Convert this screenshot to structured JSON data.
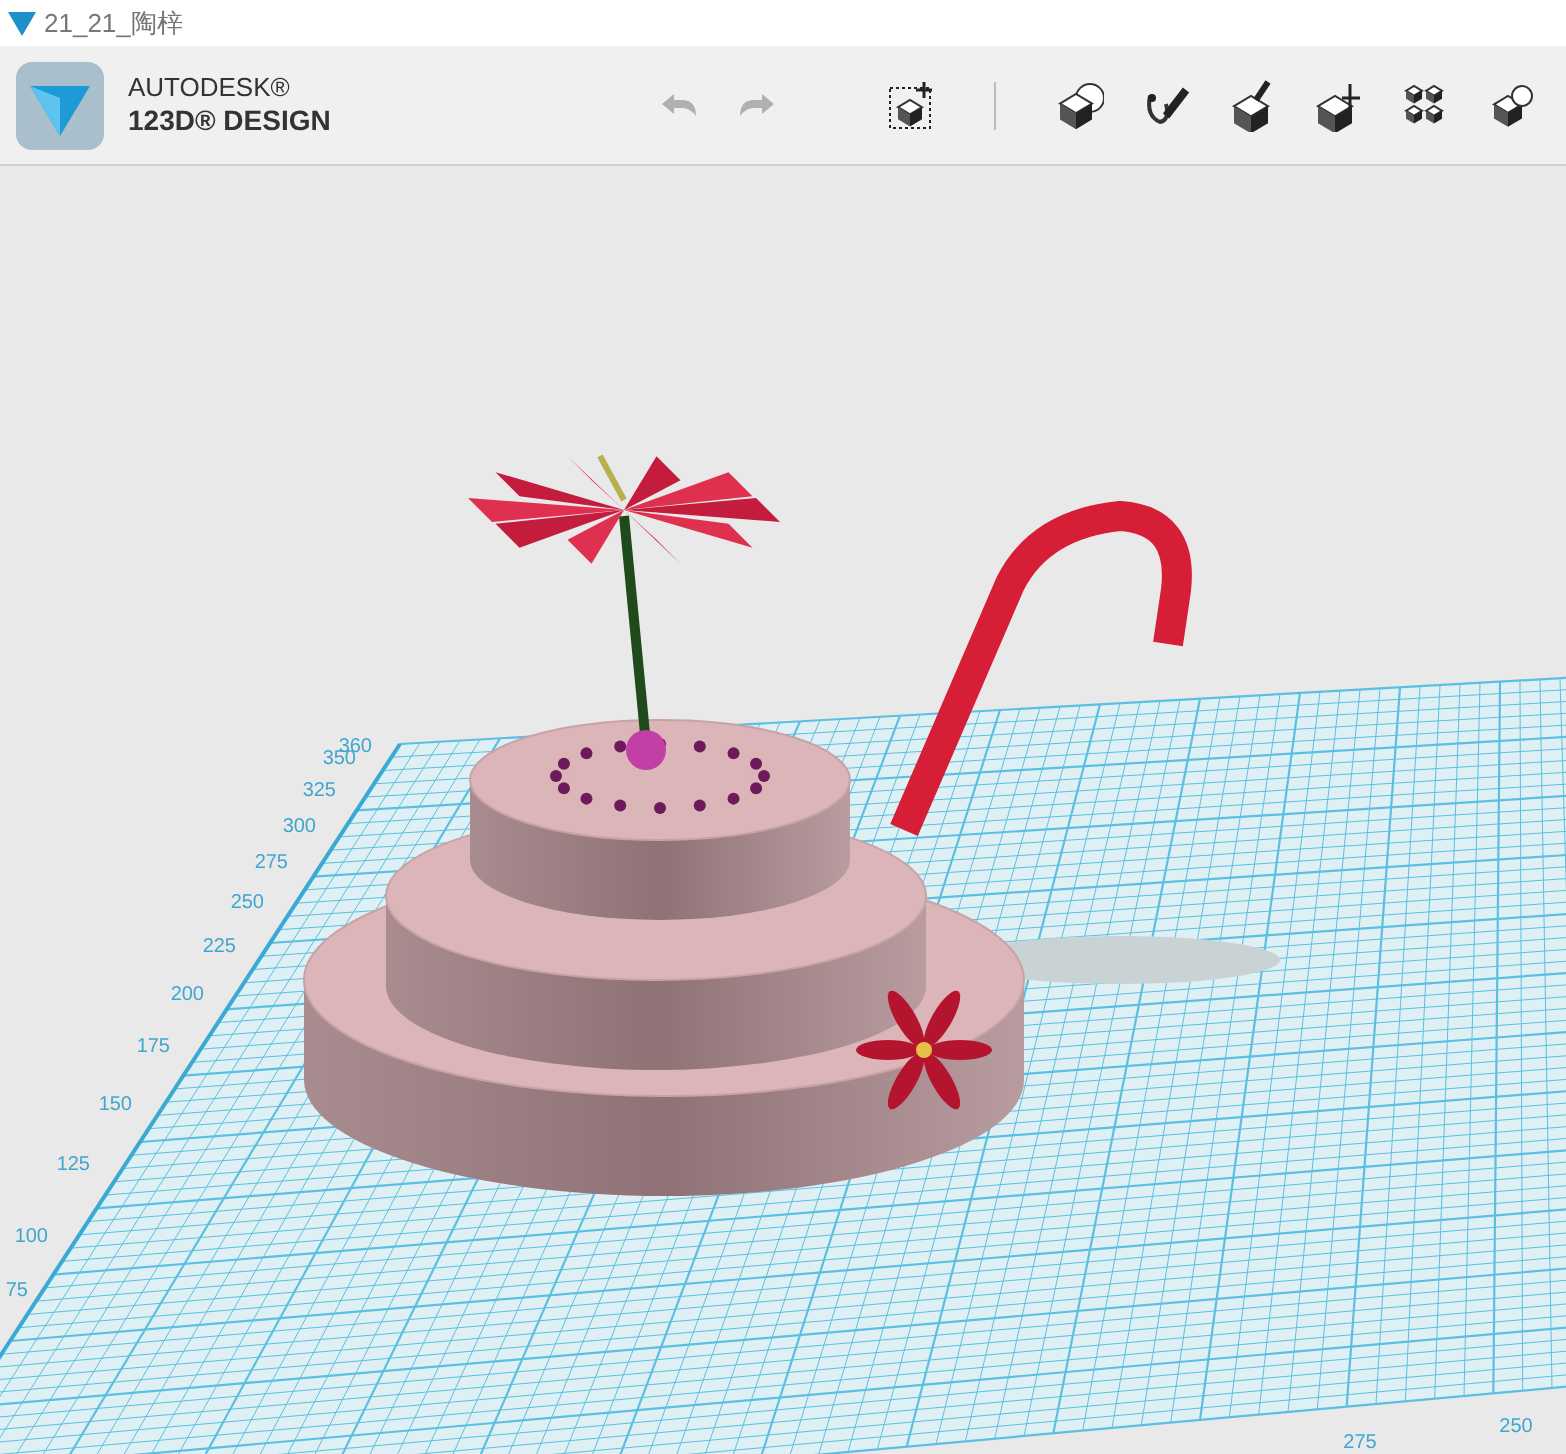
{
  "window": {
    "title": "21_21_陶梓"
  },
  "app": {
    "brand": "AUTODESK®",
    "product": "123D® DESIGN"
  },
  "history": [
    {
      "kind": "undo",
      "disabled": true
    },
    {
      "kind": "redo",
      "disabled": true
    }
  ],
  "tools": [
    {
      "kind": "transform"
    },
    {
      "kind": "primitives"
    },
    {
      "kind": "sketch"
    },
    {
      "kind": "construct"
    },
    {
      "kind": "modify"
    },
    {
      "kind": "pattern"
    },
    {
      "kind": "group"
    }
  ],
  "grid_labels": {
    "side": [
      "360",
      "350",
      "325",
      "300",
      "275",
      "250",
      "225",
      "200",
      "175",
      "150",
      "125",
      "100",
      "75"
    ],
    "front": [
      "275",
      "250"
    ]
  }
}
